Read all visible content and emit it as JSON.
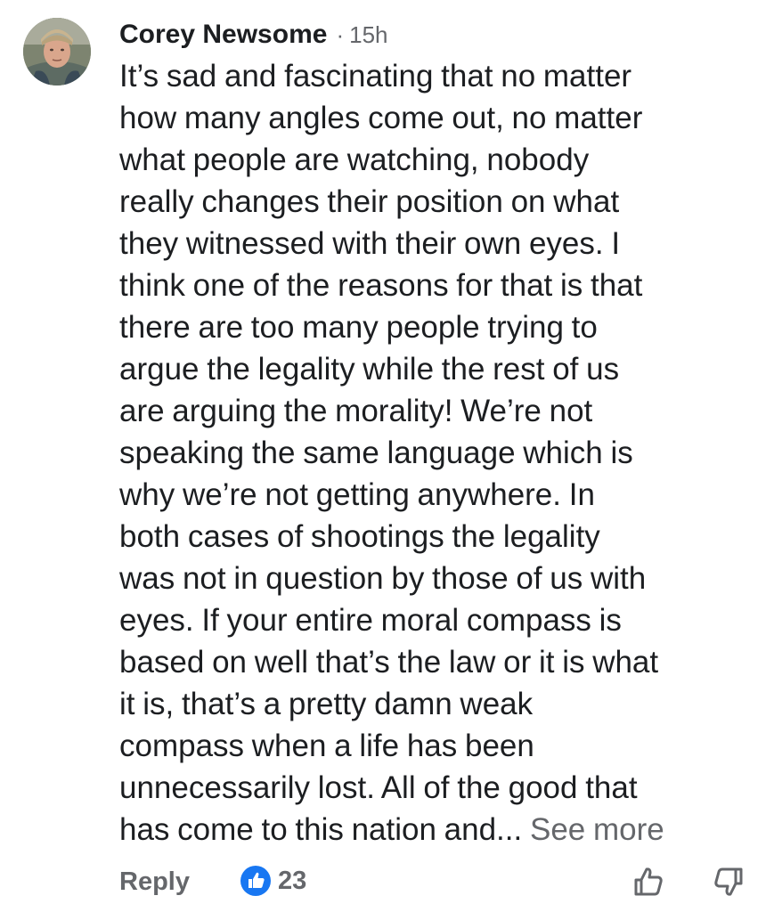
{
  "comment": {
    "author": "Corey Newsome",
    "separator": "·",
    "time": "15h",
    "avatar_icon": "user-avatar-photo",
    "lines": [
      "It’s sad and fascinating that no matter",
      "how many angles come out, no matter",
      "what people are watching, nobody",
      "really changes their position on what",
      "they witnessed with their own eyes. I",
      "think one of the reasons for that is that",
      "there are too many people trying to",
      "argue the legality while the rest of us",
      "are arguing the morality! We’re not",
      "speaking the same language which is",
      "why we’re not getting anywhere. In",
      "both cases of shootings the legality",
      "was not in question by those of us with",
      "eyes. If your entire moral compass is",
      "based on well that’s the law or it is what",
      "it is, that’s a pretty damn weak",
      "compass when a life has been",
      "unnecessarily lost. All of the good that"
    ],
    "last_line": "has come to this nation and...",
    "see_more": "See more"
  },
  "actions": {
    "reply_label": "Reply",
    "like_count": "23",
    "like_icon": "thumbs-up-badge-icon",
    "upvote_icon": "thumbs-up-outline-icon",
    "downvote_icon": "thumbs-down-outline-icon"
  },
  "colors": {
    "text_primary": "#1c1e21",
    "text_secondary": "#65676b",
    "like_blue": "#1877f2",
    "background": "#ffffff"
  }
}
